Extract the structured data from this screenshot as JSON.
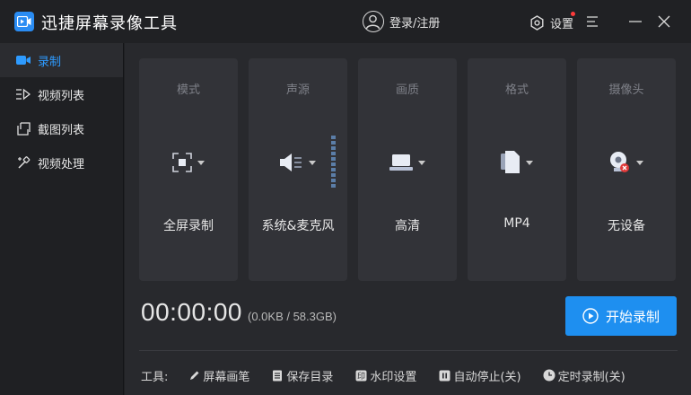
{
  "app": {
    "title": "迅捷屏幕录像工具"
  },
  "header": {
    "login_label": "登录/注册",
    "settings_label": "设置"
  },
  "sidebar": {
    "items": [
      {
        "label": "录制",
        "icon": "camera-icon",
        "active": true
      },
      {
        "label": "视频列表",
        "icon": "video-list-icon",
        "active": false
      },
      {
        "label": "截图列表",
        "icon": "screenshot-list-icon",
        "active": false
      },
      {
        "label": "视频处理",
        "icon": "video-process-icon",
        "active": false
      }
    ]
  },
  "cards": [
    {
      "title": "模式",
      "value": "全屏录制",
      "icon": "fullscreen-icon"
    },
    {
      "title": "声源",
      "value": "系统&麦克风",
      "icon": "speaker-icon"
    },
    {
      "title": "画质",
      "value": "高清",
      "icon": "laptop-icon"
    },
    {
      "title": "格式",
      "value": "MP4",
      "icon": "file-icon"
    },
    {
      "title": "摄像头",
      "value": "无设备",
      "icon": "webcam-off-icon"
    }
  ],
  "timer": {
    "time": "00:00:00",
    "size": "(0.0KB / 58.3GB)"
  },
  "record_button": {
    "label": "开始录制"
  },
  "tools": {
    "label": "工具:",
    "items": [
      {
        "label": "屏幕画笔",
        "icon": "pen-icon"
      },
      {
        "label": "保存目录",
        "icon": "folder-icon"
      },
      {
        "label": "水印设置",
        "icon": "watermark-icon"
      },
      {
        "label": "自动停止(关)",
        "icon": "pause-icon"
      },
      {
        "label": "定时录制(关)",
        "icon": "clock-icon"
      }
    ]
  },
  "colors": {
    "accent": "#1e8ff0",
    "active_text": "#2e9bff",
    "notify": "#ff3b3b"
  }
}
